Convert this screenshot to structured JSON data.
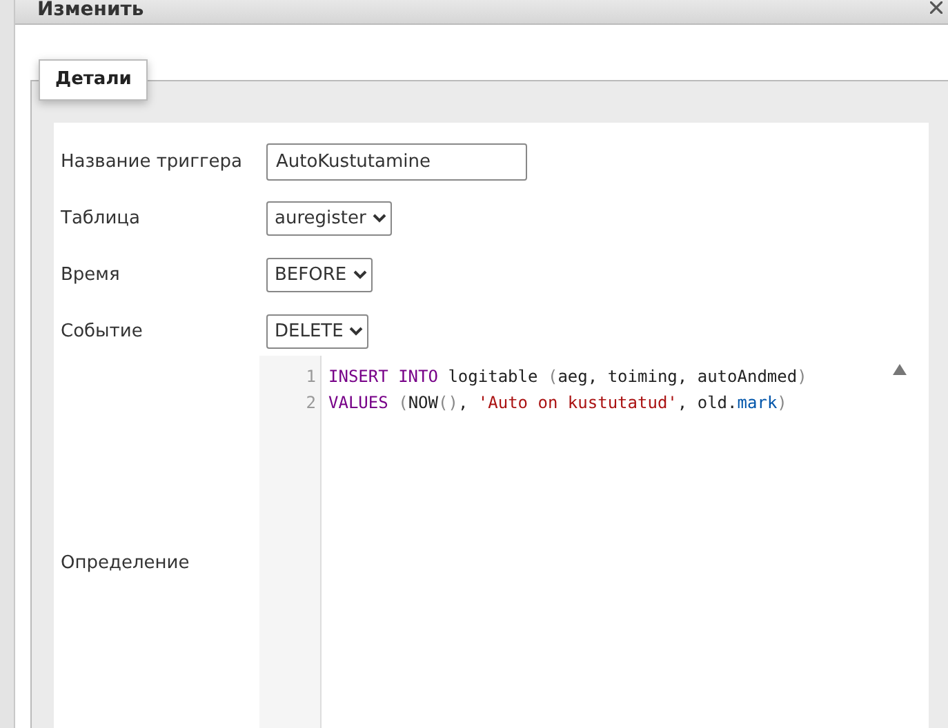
{
  "dialog": {
    "title": "Изменить"
  },
  "tabs": [
    {
      "label": "Детали",
      "selected": true
    }
  ],
  "fields": [
    {
      "label": "Название триггера",
      "kind": "text",
      "value": "AutoKustutamine"
    },
    {
      "label": "Таблица",
      "kind": "select",
      "value": "auregister"
    },
    {
      "label": "Время",
      "kind": "select",
      "value": "BEFORE"
    },
    {
      "label": "Событие",
      "kind": "select",
      "value": "DELETE"
    }
  ],
  "definition": {
    "label": "Определение",
    "lines": [
      {
        "number": "1",
        "tokens": [
          {
            "kind": "keyword",
            "text": "INSERT"
          },
          {
            "kind": "keyword",
            "text": " INTO"
          },
          {
            "kind": "plain",
            "text": " logitable "
          },
          {
            "kind": "punct",
            "text": "("
          },
          {
            "kind": "plain",
            "text": "aeg, toiming, autoAndmed"
          },
          {
            "kind": "punct",
            "text": ")"
          }
        ]
      },
      {
        "number": "2",
        "tokens": [
          {
            "kind": "keyword",
            "text": "VALUES"
          },
          {
            "kind": "punct",
            "text": " ("
          },
          {
            "kind": "plain",
            "text": "NOW"
          },
          {
            "kind": "punct",
            "text": "()"
          },
          {
            "kind": "plain",
            "text": ", "
          },
          {
            "kind": "string",
            "text": "'Auto on kustutatud'"
          },
          {
            "kind": "plain",
            "text": ", old."
          },
          {
            "kind": "property",
            "text": "mark"
          },
          {
            "kind": "punct",
            "text": ")"
          }
        ]
      }
    ]
  }
}
